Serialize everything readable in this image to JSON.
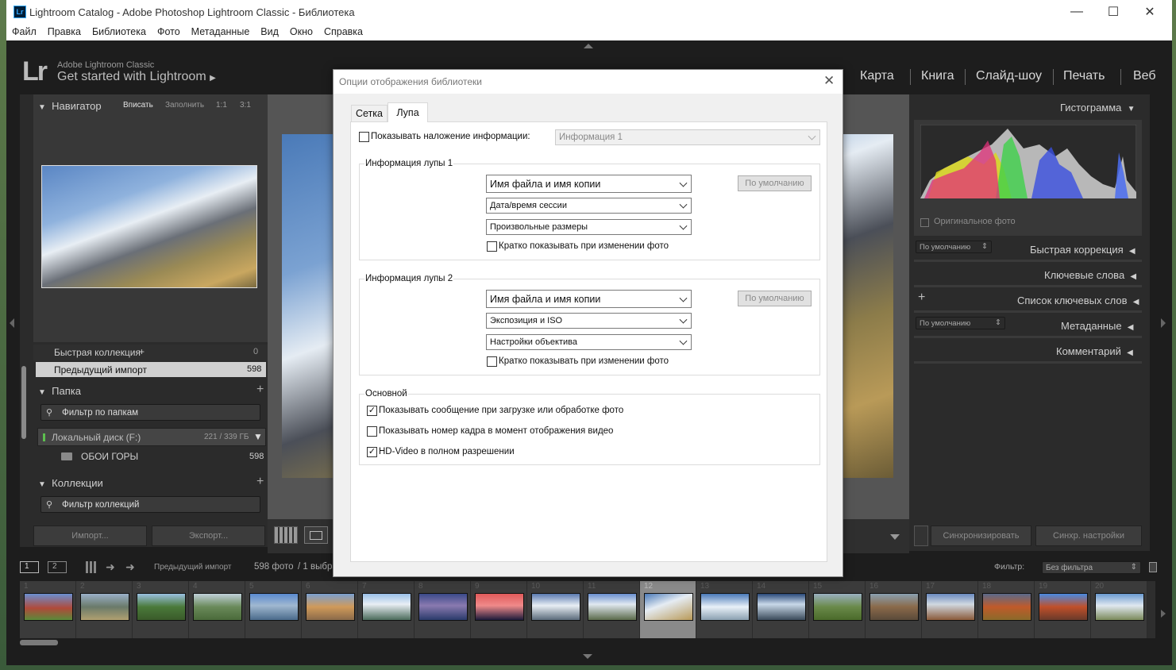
{
  "window": {
    "title": "Lightroom Catalog - Adobe Photoshop Lightroom Classic - Библиотека",
    "app_icon": "Lr"
  },
  "menu": [
    "Файл",
    "Правка",
    "Библиотека",
    "Фото",
    "Метаданные",
    "Вид",
    "Окно",
    "Справка"
  ],
  "header": {
    "logo": "Lr",
    "app_name": "Adobe Lightroom Classic",
    "identity": "Get started with Lightroom",
    "modules": [
      "Карта",
      "Книга",
      "Слайд-шоу",
      "Печать",
      "Веб"
    ]
  },
  "navigator": {
    "title": "Навигатор",
    "zoom": [
      "Вписать",
      "Заполнить",
      "1:1",
      "3:1"
    ]
  },
  "catalog": {
    "quick_collection": "Быстрая коллекция",
    "quick_collection_plus": "+",
    "quick_collection_count": "0",
    "previous_import": "Предыдущий импорт",
    "previous_import_count": "598"
  },
  "folders": {
    "title": "Папка",
    "filter_placeholder": "Фильтр по папкам",
    "disk": "Локальный диск (F:)",
    "disk_size": "221 / 339 ГБ",
    "folder_name": "ОБОИ ГОРЫ",
    "folder_count": "598"
  },
  "collections": {
    "title": "Коллекции",
    "filter_placeholder": "Фильтр коллекций"
  },
  "left_buttons": {
    "import": "Импорт...",
    "export": "Экспорт..."
  },
  "right_panel": {
    "histogram": "Гистограмма",
    "original_photo": "Оригинальное фото",
    "preset_default": "По умолчанию",
    "quick_develop": "Быстрая коррекция",
    "keywording": "Ключевые слова",
    "keyword_list": "Список ключевых слов",
    "metadata_preset": "По умолчанию",
    "metadata": "Метаданные",
    "comments": "Комментарий",
    "sync": "Синхронизировать",
    "sync_settings": "Синхр. настройки"
  },
  "filmstrip_bar": {
    "screen1": "1",
    "screen2": "2",
    "source": "Предыдущий импорт",
    "count": "598 фото",
    "selected": "/ 1 выбра",
    "filter_label": "Фильтр:",
    "filter_value": "Без фильтра"
  },
  "filmstrip": {
    "numbers": [
      "1",
      "2",
      "3",
      "4",
      "5",
      "6",
      "7",
      "8",
      "9",
      "10",
      "11",
      "12",
      "13",
      "14",
      "15",
      "16",
      "17",
      "18",
      "19",
      "20"
    ],
    "selected_index": 11
  },
  "dialog": {
    "title": "Опции отображения библиотеки",
    "tabs": [
      "Сетка",
      "Лупа"
    ],
    "active_tab": "Лупа",
    "show_overlay_label": "Показывать наложение информации:",
    "show_overlay_checked": false,
    "overlay_select": "Информация 1",
    "loupe1": {
      "title": "Информация лупы 1",
      "fields": [
        "Имя файла и имя копии",
        "Дата/время сессии",
        "Произвольные размеры"
      ],
      "default_btn": "По умолчанию",
      "brief_label": "Кратко показывать при изменении фото",
      "brief_checked": false
    },
    "loupe2": {
      "title": "Информация лупы 2",
      "fields": [
        "Имя файла и имя копии",
        "Экспозиция и ISO",
        "Настройки объектива"
      ],
      "default_btn": "По умолчанию",
      "brief_label": "Кратко показывать при изменении фото",
      "brief_checked": false
    },
    "general": {
      "title": "Основной",
      "opt1": "Показывать сообщение при загрузке или обработке фото",
      "opt1_checked": true,
      "opt2": "Показывать номер кадра в момент отображения видео",
      "opt2_checked": false,
      "opt3": "HD-Video в полном разрешении",
      "opt3_checked": true
    }
  }
}
